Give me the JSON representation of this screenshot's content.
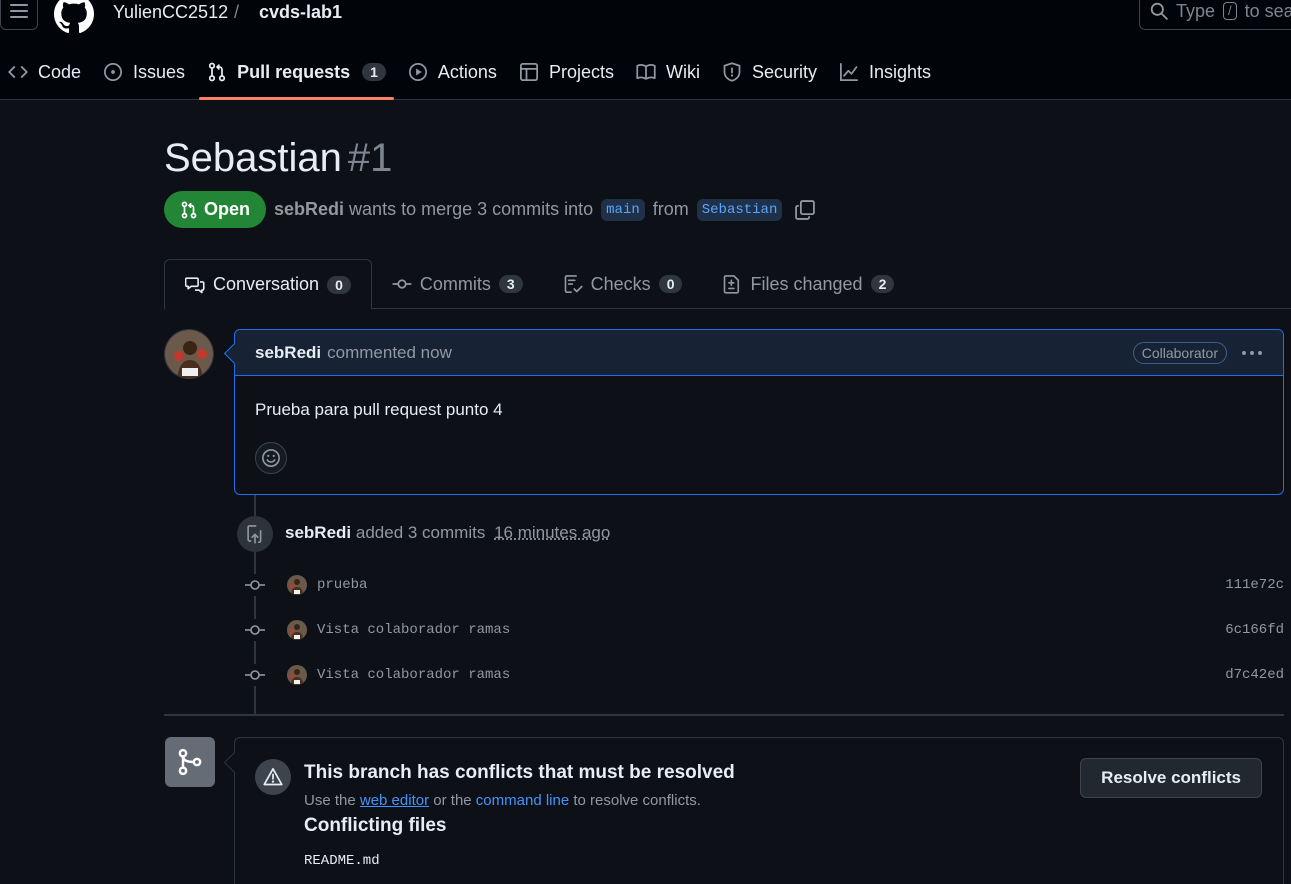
{
  "header": {
    "owner": "YulienCC2512",
    "separator": "/",
    "repo": "cvds-lab1",
    "search": {
      "prefix": "Type",
      "key": "/",
      "suffix": "to sea"
    }
  },
  "nav": {
    "code": "Code",
    "issues": "Issues",
    "pull_requests": "Pull requests",
    "pull_requests_count": "1",
    "actions": "Actions",
    "projects": "Projects",
    "wiki": "Wiki",
    "security": "Security",
    "insights": "Insights"
  },
  "pr": {
    "title": "Sebastian",
    "number": "#1",
    "state": "Open",
    "author": "sebRedi",
    "merge_text": "wants to merge 3 commits into",
    "base": "main",
    "from_text": "from",
    "head": "Sebastian"
  },
  "tabs": {
    "conversation": "Conversation",
    "conversation_count": "0",
    "commits": "Commits",
    "commits_count": "3",
    "checks": "Checks",
    "checks_count": "0",
    "files": "Files changed",
    "files_count": "2"
  },
  "comment": {
    "author": "sebRedi",
    "time": "commented now",
    "role": "Collaborator",
    "body": "Prueba para pull request punto 4"
  },
  "timeline": {
    "author": "sebRedi",
    "action": "added 3 commits",
    "ago": "16 minutes ago",
    "commits": [
      {
        "message": "prueba",
        "sha": "111e72c"
      },
      {
        "message": "Vista colaborador ramas",
        "sha": "6c166fd"
      },
      {
        "message": "Vista colaborador ramas",
        "sha": "d7c42ed"
      }
    ]
  },
  "merge": {
    "title": "This branch has conflicts that must be resolved",
    "sub_use": "Use the",
    "web_editor": "web editor",
    "sub_or": "or the",
    "command_line": "command line",
    "sub_end": "to resolve conflicts.",
    "resolve_button": "Resolve conflicts",
    "conflicting_heading": "Conflicting files",
    "files": [
      "README.md"
    ]
  },
  "colors": {
    "background": "#0d1117",
    "header_bg": "#010409",
    "open_green": "#238636",
    "link_blue": "#4493f8",
    "active_tab_underline": "#f78166",
    "comment_border": "#1f6feb"
  }
}
